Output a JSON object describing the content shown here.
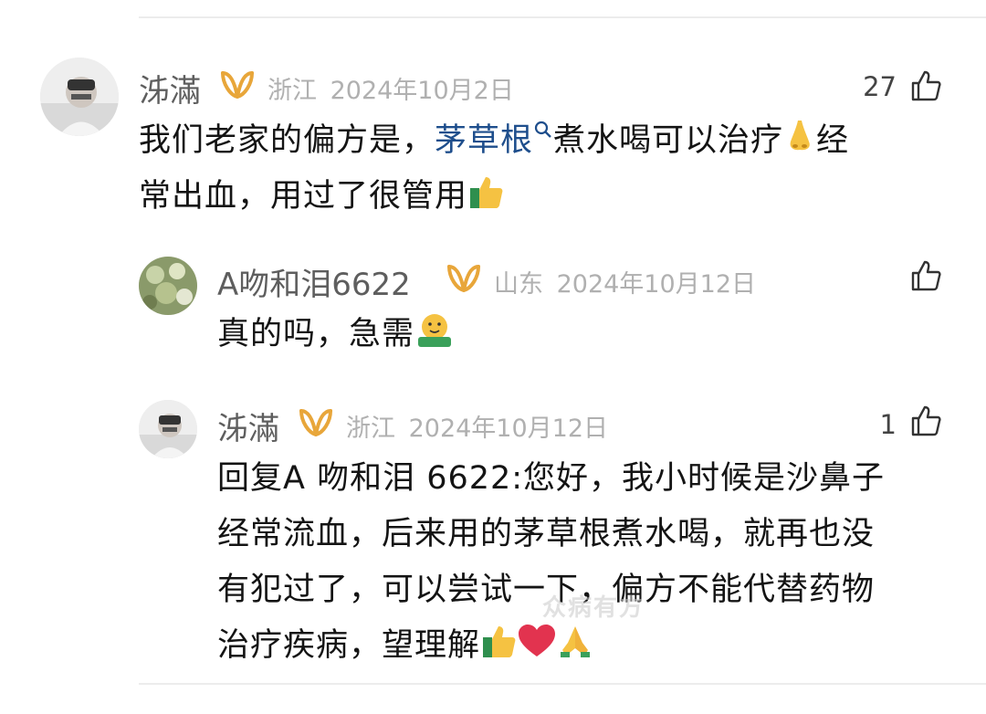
{
  "comments": [
    {
      "username": "泲滿",
      "location": "浙江",
      "date": "2024年10月2日",
      "likes": "27",
      "text_before_link": "我们老家的偏方是，",
      "link_text": "茅草根",
      "text_after_link": "煮水喝可以治疗",
      "text_line2": "经",
      "text_line3": "常出血，用过了很管用"
    },
    {
      "username": "A吻和泪6622",
      "location": "山东",
      "date": "2024年10月12日",
      "likes": "",
      "text": "真的吗，急需"
    },
    {
      "username": "泲滿",
      "location": "浙江",
      "date": "2024年10月12日",
      "likes": "1",
      "lines": [
        "回复A 吻和泪 6622:您好，我小时候是沙鼻子",
        "经常流血，后来用的茅草根煮水喝，就再也没",
        "有犯过了，可以尝试一下，偏方不能代替药物",
        "治疗疾病，望理解"
      ]
    }
  ],
  "watermark": "众病有方",
  "colors": {
    "vip_badge": "#e8a63a",
    "link": "#1e4e8c",
    "meta": "#b0b0b0"
  },
  "icons": [
    "vip-badge-icon",
    "thumbs-up-icon",
    "search-icon",
    "nose-emoji",
    "thumbs-up-emoji",
    "money-mouth-emoji",
    "heart-emoji",
    "pray-emoji"
  ]
}
